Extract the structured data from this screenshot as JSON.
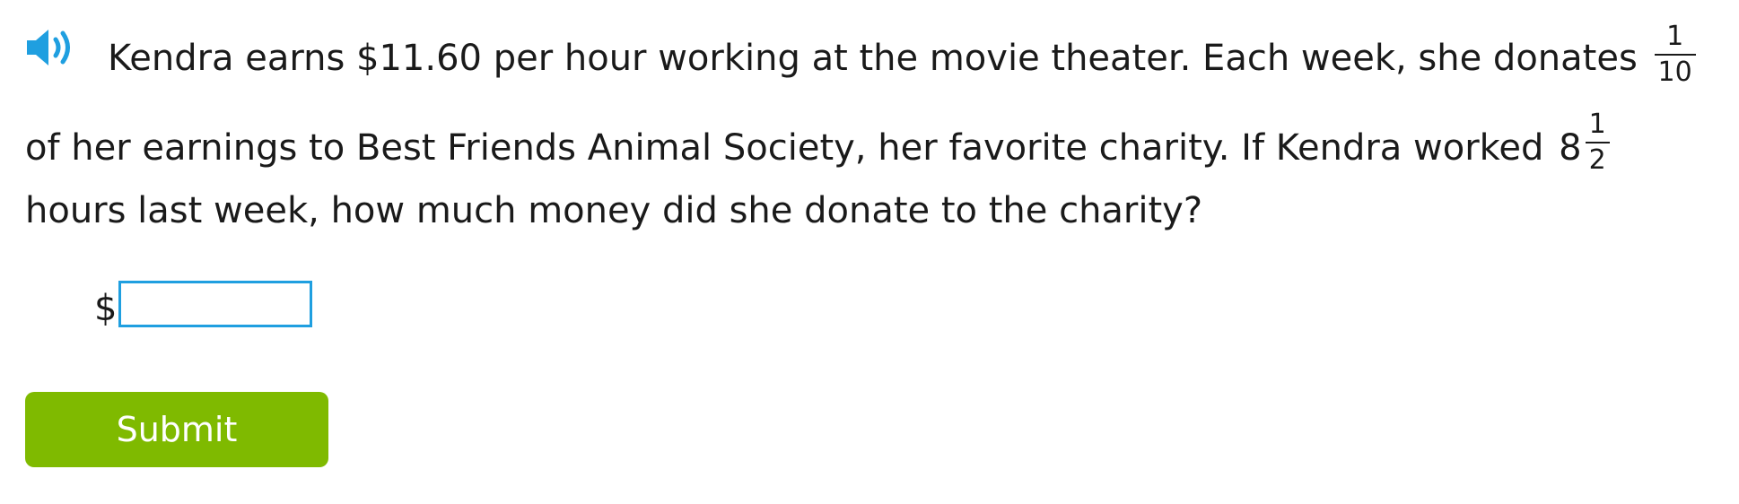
{
  "question": {
    "line1_text": "Kendra earns $11.60 per hour working at the movie theater. Each week, she donates",
    "fraction_donation": {
      "numerator": "1",
      "denominator": "10"
    },
    "line2_text": "of her earnings to Best Friends Animal Society, her favorite charity. If Kendra worked",
    "mixed_hours": {
      "whole": "8",
      "numerator": "1",
      "denominator": "2"
    },
    "line3_text": "hours last week, how much money did she donate to the charity?"
  },
  "answer": {
    "currency_symbol": "$",
    "value": "",
    "placeholder": ""
  },
  "actions": {
    "submit_label": "Submit"
  },
  "colors": {
    "accent_blue": "#1f9fe0",
    "submit_green": "#7fba00",
    "text": "#1a1a1a"
  },
  "icons": {
    "audio": "speaker-icon"
  }
}
